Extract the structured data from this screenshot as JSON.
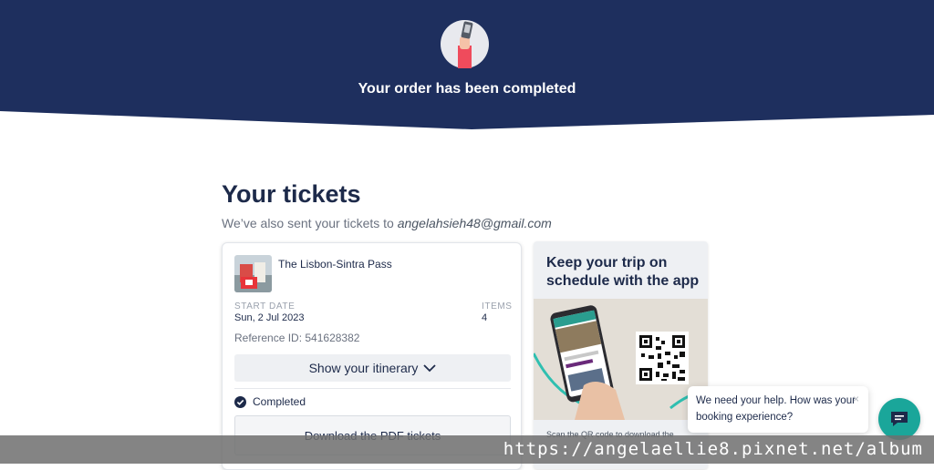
{
  "header": {
    "title": "Your order has been completed",
    "bg_color": "#1e2f5e"
  },
  "tickets": {
    "heading": "Your tickets",
    "sent_text": "We’ve also sent your tickets to ",
    "email": "angelahsieh48@gmail.com"
  },
  "order": {
    "product_name": "The Lisbon-Sintra Pass",
    "start_date_label": "START DATE",
    "start_date": "Sun, 2 Jul 2023",
    "items_label": "ITEMS",
    "items": "4",
    "reference": "Reference ID: 541628382",
    "itinerary_button": "Show your itinerary",
    "status": "Completed",
    "download_button": "Download the PDF tickets"
  },
  "app_promo": {
    "title": "Keep your trip on schedule with the app",
    "caption": "Scan the QR code to download the"
  },
  "chat": {
    "message": "We need your help. How was your booking experience?",
    "close_symbol": "×",
    "accent_color": "#1aa69a"
  },
  "watermark": {
    "text": "https://angelaellie8.pixnet.net/album"
  }
}
